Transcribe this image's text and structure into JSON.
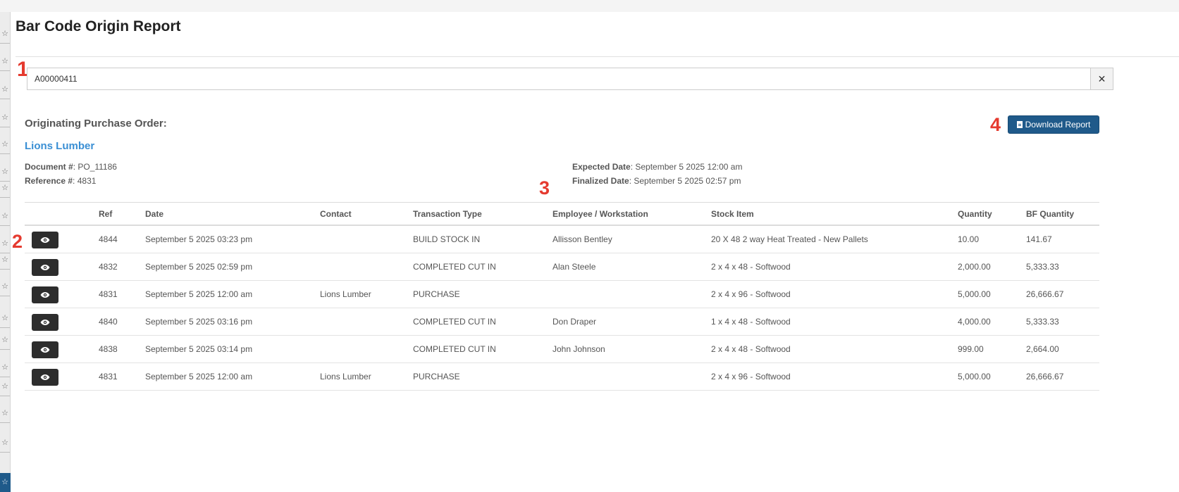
{
  "page": {
    "title": "Bar Code Origin Report"
  },
  "search": {
    "value": "A00000411",
    "clear_label": "✕"
  },
  "markers": [
    "1",
    "2",
    "3",
    "4"
  ],
  "purchase_order": {
    "heading": "Originating Purchase Order:",
    "vendor": "Lions Lumber",
    "document_label": "Document #",
    "document_value": ": PO_11186",
    "reference_label": "Reference #",
    "reference_value": ": 4831",
    "expected_label": "Expected Date",
    "expected_value": ": September 5 2025 12:00 am",
    "finalized_label": "Finalized Date",
    "finalized_value": ": September 5 2025 02:57 pm"
  },
  "actions": {
    "download_label": "Download Report"
  },
  "table": {
    "headers": [
      "Ref",
      "Date",
      "Contact",
      "Transaction Type",
      "Employee / Workstation",
      "Stock Item",
      "Quantity",
      "BF Quantity"
    ],
    "rows": [
      {
        "ref": "4844",
        "date": "September 5 2025 03:23 pm",
        "contact": "",
        "type": "BUILD STOCK IN",
        "employee": "Allisson Bentley",
        "item": "20 X 48 2 way Heat Treated - New Pallets",
        "qty": "10.00",
        "bf": "141.67"
      },
      {
        "ref": "4832",
        "date": "September 5 2025 02:59 pm",
        "contact": "",
        "type": "COMPLETED CUT IN",
        "employee": "Alan Steele",
        "item": "2 x 4 x 48 - Softwood",
        "qty": "2,000.00",
        "bf": "5,333.33"
      },
      {
        "ref": "4831",
        "date": "September 5 2025 12:00 am",
        "contact": "Lions Lumber",
        "type": "PURCHASE",
        "employee": "",
        "item": "2 x 4 x 96 - Softwood",
        "qty": "5,000.00",
        "bf": "26,666.67"
      },
      {
        "ref": "4840",
        "date": "September 5 2025 03:16 pm",
        "contact": "",
        "type": "COMPLETED CUT IN",
        "employee": "Don Draper",
        "item": "1 x 4 x 48 - Softwood",
        "qty": "4,000.00",
        "bf": "5,333.33"
      },
      {
        "ref": "4838",
        "date": "September 5 2025 03:14 pm",
        "contact": "",
        "type": "COMPLETED CUT IN",
        "employee": "John Johnson",
        "item": "2 x 4 x 48 - Softwood",
        "qty": "999.00",
        "bf": "2,664.00"
      },
      {
        "ref": "4831",
        "date": "September 5 2025 12:00 am",
        "contact": "Lions Lumber",
        "type": "PURCHASE",
        "employee": "",
        "item": "2 x 4 x 96 - Softwood",
        "qty": "5,000.00",
        "bf": "26,666.67"
      }
    ]
  },
  "icons": {
    "sidebar": "star-icon",
    "view": "eye-icon",
    "download": "file-icon"
  },
  "colors": {
    "accent": "#1f5a8a",
    "link": "#3a8fd4",
    "marker": "#e53a2f",
    "view_button": "#2d2d2d"
  }
}
